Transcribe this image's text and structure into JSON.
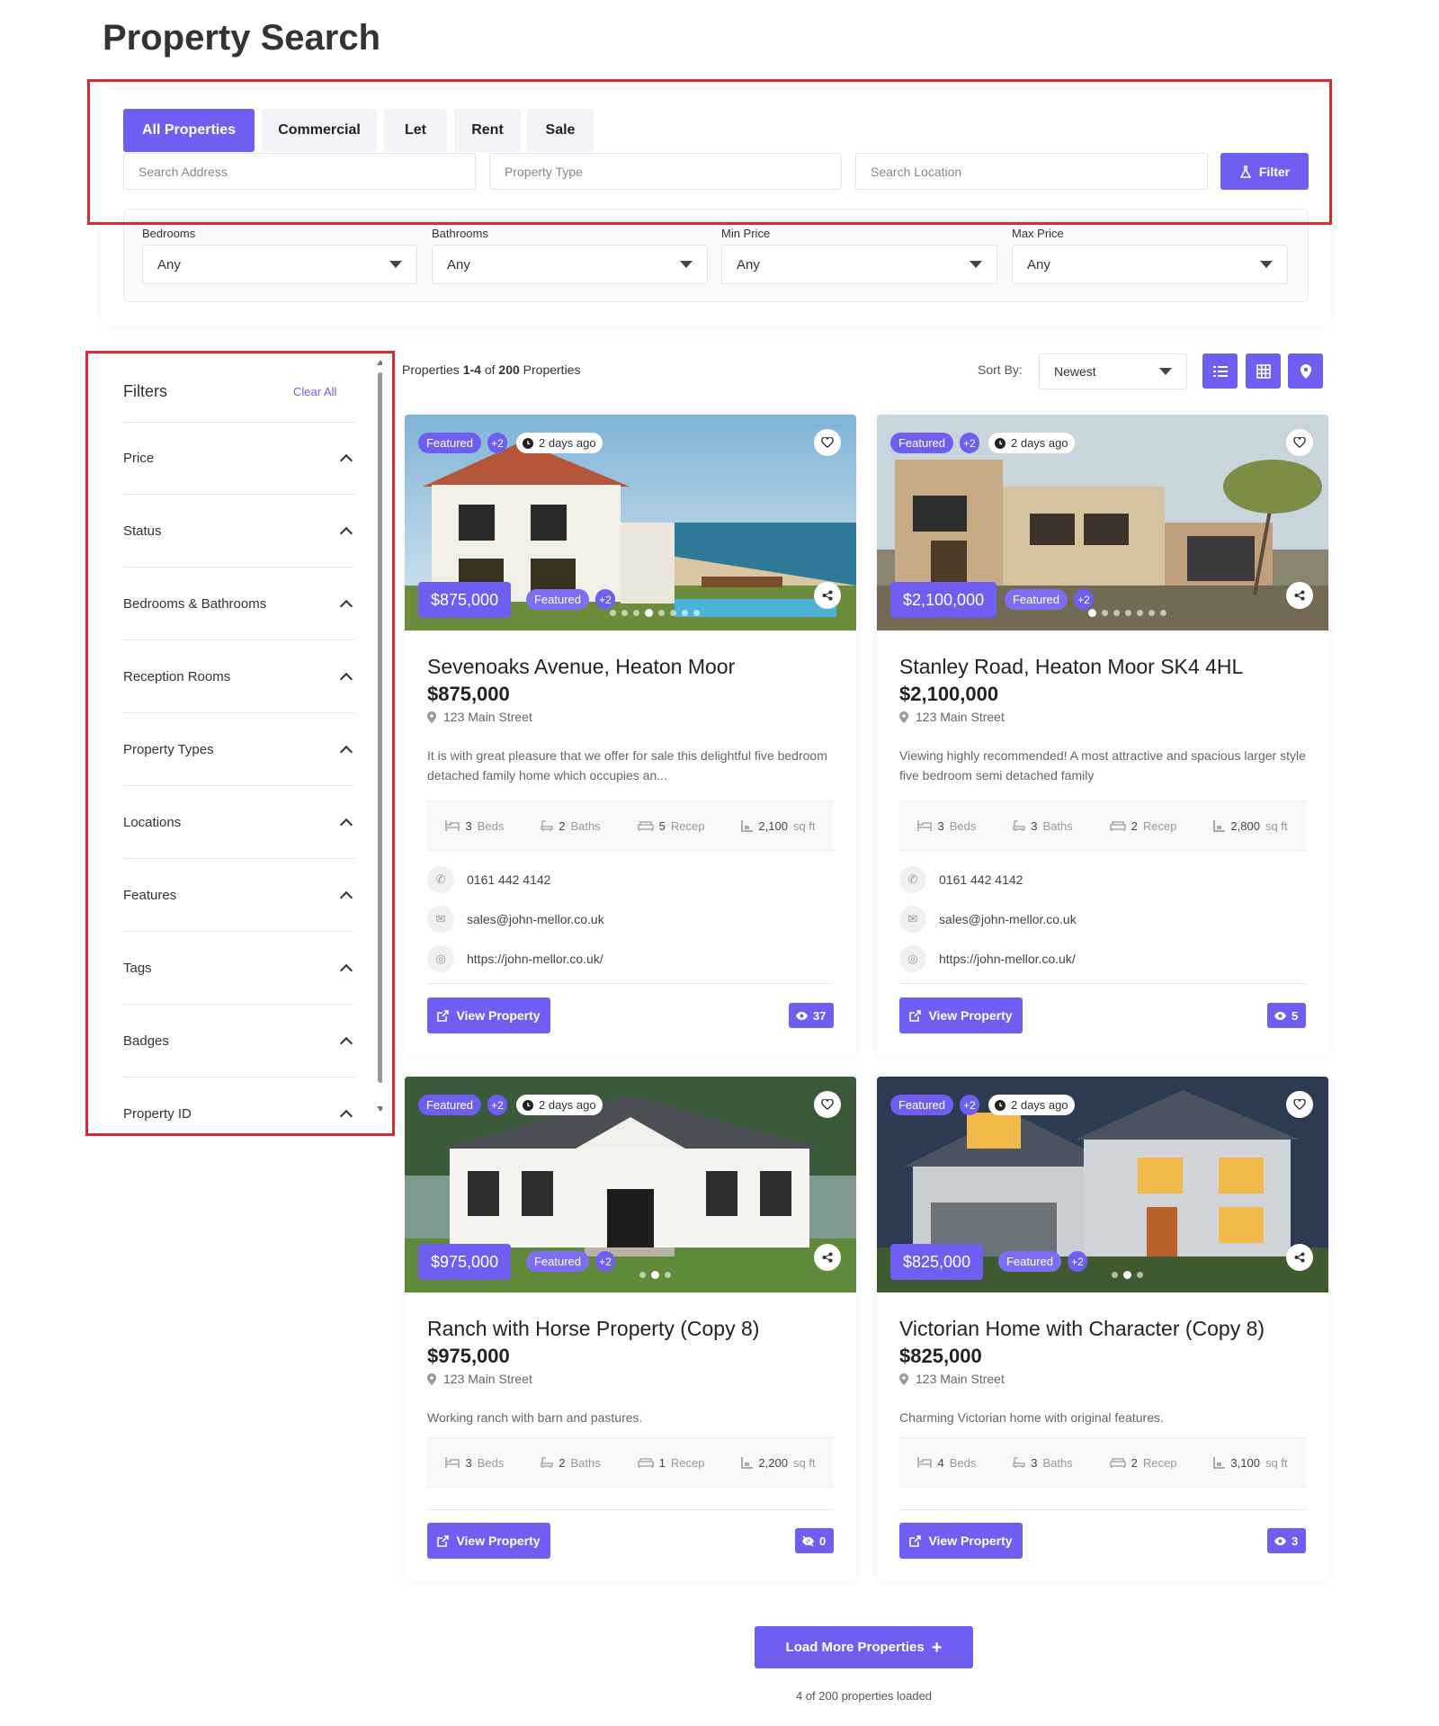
{
  "page": {
    "title": "Property Search"
  },
  "search": {
    "tabs": [
      "All Properties",
      "Commercial",
      "Let",
      "Rent",
      "Sale"
    ],
    "address_placeholder": "Search Address",
    "type_placeholder": "Property Type",
    "location_placeholder": "Search Location",
    "filter_label": "Filter"
  },
  "advanced": {
    "bedrooms": {
      "label": "Bedrooms",
      "value": "Any"
    },
    "bathrooms": {
      "label": "Bathrooms",
      "value": "Any"
    },
    "min_price": {
      "label": "Min Price",
      "value": "Any"
    },
    "max_price": {
      "label": "Max Price",
      "value": "Any"
    }
  },
  "sidebar": {
    "title": "Filters",
    "clear_all": "Clear All",
    "items": [
      "Price",
      "Status",
      "Bedrooms & Bathrooms",
      "Reception Rooms",
      "Property Types",
      "Locations",
      "Features",
      "Tags",
      "Badges",
      "Property ID"
    ]
  },
  "results": {
    "prefix": "Properties ",
    "range": "1-4",
    "of": " of ",
    "total": "200",
    "suffix": " Properties",
    "sort_label": "Sort By:",
    "sort_value": "Newest"
  },
  "labels": {
    "featured": "Featured",
    "more": "+2",
    "ago": "2 days ago",
    "view": "View Property",
    "beds": "Beds",
    "baths": "Baths",
    "recep": "Recep",
    "sqft": "sq ft"
  },
  "cards": [
    {
      "title": "Sevenoaks Avenue, Heaton Moor",
      "price": "$875,000",
      "address": "123 Main Street",
      "desc": "It is with great pleasure that we offer for sale this delightful five bedroom detached family home which occupies an...",
      "beds": "3",
      "baths": "2",
      "recep": "5",
      "sqft": "2,100",
      "phone": "0161 442 4142",
      "email": "sales@john-mellor.co.uk",
      "web": "https://john-mellor.co.uk/",
      "views": "37"
    },
    {
      "title": "Stanley Road, Heaton Moor SK4 4HL",
      "price": "$2,100,000",
      "address": "123 Main Street",
      "desc": "Viewing highly recommended! A most attractive and spacious larger style five bedroom semi detached family",
      "beds": "3",
      "baths": "3",
      "recep": "2",
      "sqft": "2,800",
      "phone": "0161 442 4142",
      "email": "sales@john-mellor.co.uk",
      "web": "https://john-mellor.co.uk/",
      "views": "5"
    },
    {
      "title": "Ranch with Horse Property (Copy 8)",
      "price": "$975,000",
      "address": "123 Main Street",
      "desc": "Working ranch with barn and pastures.",
      "beds": "3",
      "baths": "2",
      "recep": "1",
      "sqft": "2,200",
      "views": "0"
    },
    {
      "title": "Victorian Home with Character (Copy 8)",
      "price": "$825,000",
      "address": "123 Main Street",
      "desc": "Charming Victorian home with original features.",
      "beds": "4",
      "baths": "3",
      "recep": "2",
      "sqft": "3,100",
      "views": "3"
    }
  ],
  "footer": {
    "load_more": "Load More Properties",
    "loaded": "4 of 200 properties loaded"
  },
  "colors": {
    "accent": "#6e5ff2",
    "highlight": "#d62b37"
  }
}
